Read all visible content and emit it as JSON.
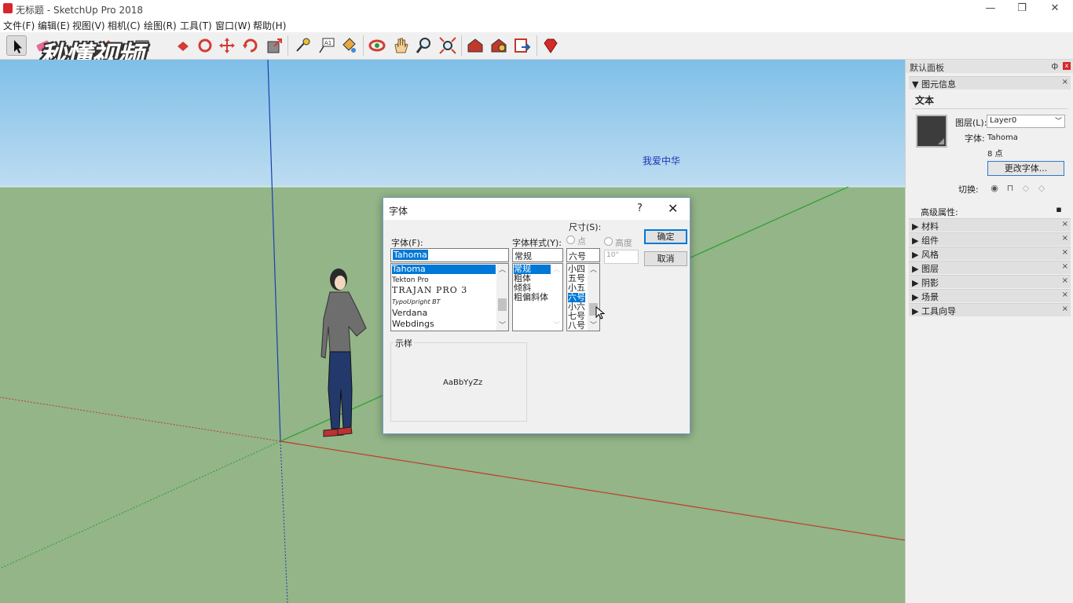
{
  "window": {
    "title": "无标题 - SketchUp Pro 2018",
    "minimize": "—",
    "restore": "❐",
    "close": "✕"
  },
  "menu": [
    "文件(F)",
    "编辑(E)",
    "视图(V)",
    "相机(C)",
    "绘图(R)",
    "工具(T)",
    "窗口(W)",
    "帮助(H)"
  ],
  "watermark": "秒懂视频",
  "toolbar": {
    "icons": [
      "select-icon",
      "eraser-icon",
      "pencil-icon",
      "rectangle-icon",
      "push-pull-icon",
      "paint-icon",
      "move-icon",
      "rotate-icon",
      "scale-icon",
      "tape-measure-icon",
      "text-icon",
      "paint-bucket-icon",
      "orbit-icon",
      "pan-icon",
      "zoom-icon",
      "zoom-extents-icon",
      "warehouse-icon",
      "extension-warehouse-icon",
      "send-to-layout-icon",
      "ruby-icon"
    ]
  },
  "scene": {
    "text_label": "我爱中华",
    "colors": {
      "sky": "#7fbfe8",
      "ground": "#93b588",
      "blue_axis": "#1a3fb0",
      "green_axis": "#27a02c",
      "red_axis": "#c0392b"
    }
  },
  "panel": {
    "title": "默认面板",
    "pin": "ф",
    "close": "x",
    "entity_tray": {
      "title": "图元信息",
      "type": "文本",
      "layer_label": "图层(L):",
      "layer_value": "Layer0",
      "font_label": "字体:",
      "font_value": "Tahoma",
      "size_value": "8 点",
      "change_font_button": "更改字体...",
      "toggle_label": "切换:",
      "advanced_label": "高级属性:"
    },
    "trays": [
      "材料",
      "组件",
      "风格",
      "图层",
      "阴影",
      "场景",
      "工具向导"
    ],
    "tray_close": "×"
  },
  "font_dialog": {
    "title": "字体",
    "help": "?",
    "close": "✕",
    "font_label": "字体(F):",
    "font_value": "Tahoma",
    "font_list": [
      "Tahoma",
      "Tekton Pro",
      "TRAJAN PRO 3",
      "TypoUpright BT",
      "Verdana",
      "Webdings"
    ],
    "font_selected_index": 0,
    "style_label": "字体样式(Y):",
    "style_value": "常规",
    "style_list": [
      "常规",
      "粗体",
      "倾斜",
      "粗偏斜体"
    ],
    "style_selected_index": 0,
    "size_label": "尺寸(S):",
    "size_value": "六号",
    "size_list": [
      "小四",
      "五号",
      "小五",
      "六号",
      "小六",
      "七号",
      "八号"
    ],
    "size_selected_index": 3,
    "points_label": "点",
    "height_label": "高度",
    "height_value": "10\"",
    "ok_button": "确定",
    "cancel_button": "取消",
    "sample_label": "示样",
    "sample_text": "AaBbYyZz"
  }
}
